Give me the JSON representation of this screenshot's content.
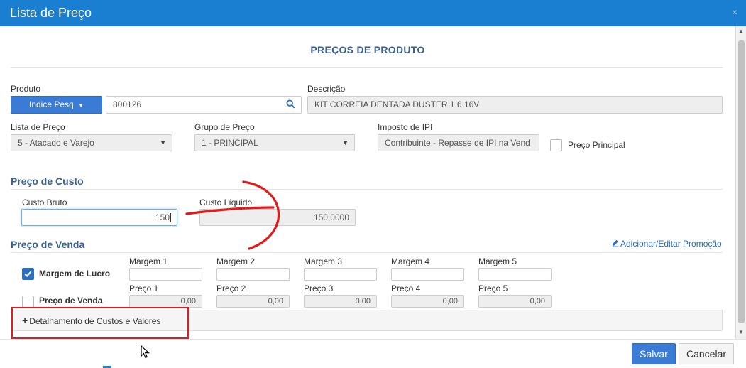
{
  "dialog": {
    "title": "Lista de Preço",
    "close_icon": "×"
  },
  "section_title": "PREÇOS DE PRODUTO",
  "produto": {
    "label": "Produto",
    "index_button": "Indice Pesq",
    "code_value": "800126"
  },
  "descricao": {
    "label": "Descrição",
    "value": "KIT CORREIA DENTADA DUSTER 1.6 16V"
  },
  "lista_preco": {
    "label": "Lista de Preço",
    "value": "5 - Atacado e Varejo"
  },
  "grupo_preco": {
    "label": "Grupo de Preço",
    "value": "1 - PRINCIPAL"
  },
  "imposto_ipi": {
    "label": "Imposto de IPI",
    "value": "Contribuinte - Repasse de IPI na Vend"
  },
  "preco_principal": {
    "label": "Preço Principal",
    "checked": false
  },
  "preco_custo": {
    "heading": "Preço de Custo",
    "custo_bruto_label": "Custo Bruto",
    "custo_bruto_value": "150",
    "custo_liquido_label": "Custo Líquido",
    "custo_liquido_value": "150,0000"
  },
  "preco_venda": {
    "heading": "Preço de Venda",
    "promo_link": "Adicionar/Editar Promoção",
    "margem_lucro_label": "Margem de Lucro",
    "margem_lucro_checked": true,
    "preco_venda_label": "Preço de Venda",
    "preco_venda_checked": false,
    "margens": [
      {
        "label": "Margem 1",
        "value": ""
      },
      {
        "label": "Margem 2",
        "value": ""
      },
      {
        "label": "Margem 3",
        "value": ""
      },
      {
        "label": "Margem 4",
        "value": ""
      },
      {
        "label": "Margem 5",
        "value": ""
      }
    ],
    "precos": [
      {
        "label": "Preço 1",
        "value": "0,00"
      },
      {
        "label": "Preço 2",
        "value": "0,00"
      },
      {
        "label": "Preço 3",
        "value": "0,00"
      },
      {
        "label": "Preço 4",
        "value": "0,00"
      },
      {
        "label": "Preço 5",
        "value": "0,00"
      }
    ]
  },
  "detalhamento": {
    "label": "Detalhamento de Custos e Valores",
    "icon": "+"
  },
  "footer": {
    "save": "Salvar",
    "cancel": "Cancelar"
  },
  "colors": {
    "header": "#1a7fd0",
    "primary": "#3a7bd5",
    "heading": "#3a5f93",
    "annotation": "#e11b1b"
  }
}
